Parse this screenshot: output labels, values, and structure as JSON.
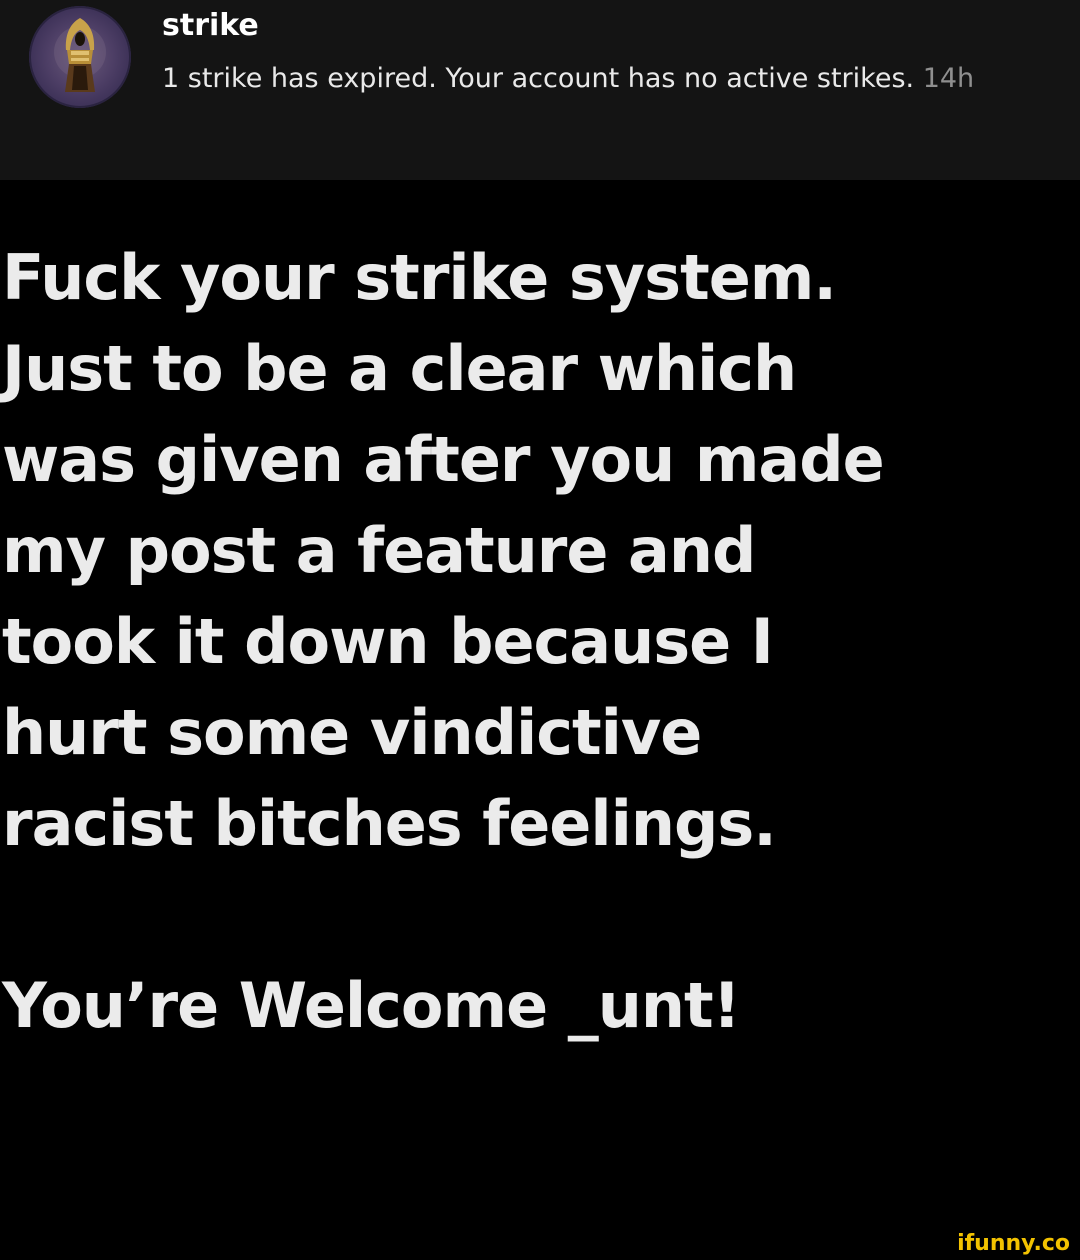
{
  "notification": {
    "title": "strike",
    "message": "1 strike has expired. Your account has no active strikes.",
    "time": "14h",
    "avatar_icon": "hooded-figure-icon"
  },
  "post": {
    "lines": [
      "Fuck your strike system.",
      "Just to be a clear which",
      "was given after you made",
      "my post a feature and",
      "took it down because I",
      "hurt some vindictive",
      "racist bitches feelings."
    ],
    "closing": "You’re Welcome _unt!"
  },
  "watermark": {
    "text": "ifunny.co"
  },
  "colors": {
    "background": "#000000",
    "notification_bg": "#141414",
    "text": "#ebebeb",
    "muted": "#8f8f8f",
    "watermark": "#f2c200"
  }
}
